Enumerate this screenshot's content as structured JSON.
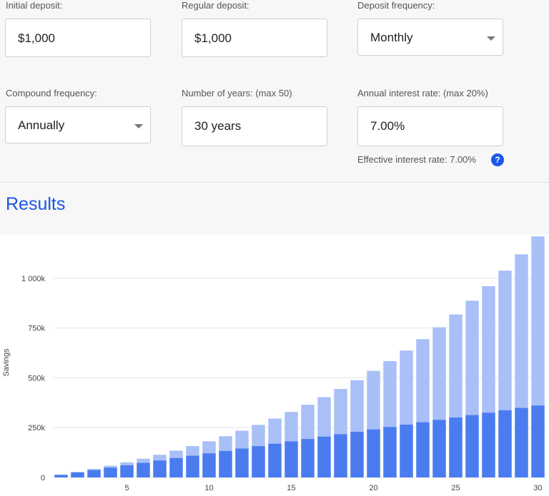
{
  "form": {
    "initial_deposit": {
      "label": "Initial deposit:",
      "value": "$1,000"
    },
    "regular_deposit": {
      "label": "Regular deposit:",
      "value": "$1,000"
    },
    "deposit_frequency": {
      "label": "Deposit frequency:",
      "value": "Monthly"
    },
    "compound_frequency": {
      "label": "Compound frequency:",
      "value": "Annually"
    },
    "number_of_years": {
      "label": "Number of years: (max 50)",
      "value": "30 years"
    },
    "annual_interest_rate": {
      "label": "Annual interest rate: (max 20%)",
      "value": "7.00%"
    },
    "effective_rate": "Effective interest rate: 7.00%",
    "help_icon": "?"
  },
  "results": {
    "title": "Results"
  },
  "colors": {
    "accent": "#1a56e8",
    "principal": "#4a7cf0",
    "interest": "#a8bff7"
  },
  "chart_data": {
    "type": "bar",
    "stacked": true,
    "ylabel": "Savings",
    "xlabel": "",
    "ylim": [
      0,
      1150000
    ],
    "yticks": [
      0,
      250000,
      500000,
      750000,
      1000000
    ],
    "ytick_labels": [
      "0",
      "250k",
      "500k",
      "750k",
      "1 000k"
    ],
    "xticks": [
      5,
      10,
      15,
      20,
      25,
      30
    ],
    "grid": true,
    "categories": [
      1,
      2,
      3,
      4,
      5,
      6,
      7,
      8,
      9,
      10,
      11,
      12,
      13,
      14,
      15,
      16,
      17,
      18,
      19,
      20,
      21,
      22,
      23,
      24,
      25,
      26,
      27,
      28,
      29,
      30
    ],
    "series": [
      {
        "values": [
          13000,
          25000,
          37000,
          49000,
          61000,
          73000,
          85000,
          97000,
          109000,
          121000,
          133000,
          145000,
          157000,
          169000,
          181000,
          193000,
          205000,
          217000,
          229000,
          241000,
          253000,
          265000,
          277000,
          289000,
          301000,
          313000,
          325000,
          337000,
          349000,
          361000
        ]
      },
      {
        "values": [
          13910,
          27804,
          42600,
          58600,
          75800,
          94200,
          113800,
          134800,
          157200,
          181400,
          207000,
          234500,
          264000,
          295500,
          329000,
          365000,
          403000,
          444000,
          488000,
          535000,
          584000,
          637000,
          694000,
          754000,
          818000,
          887000,
          960000,
          1038000,
          1120000,
          1210000
        ]
      }
    ]
  }
}
